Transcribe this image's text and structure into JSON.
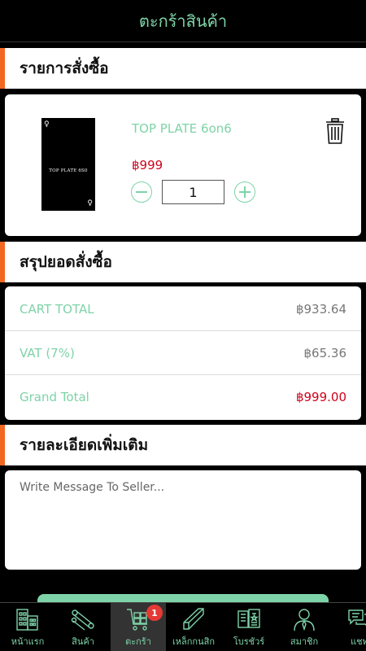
{
  "header": {
    "title": "ตะกร้าสินค้า"
  },
  "sections": {
    "order_items": "รายการสั่งซื้อ",
    "order_summary": "สรุปยอดสั่งซื้อ",
    "extra_details": "รายละเอียดเพิ่มเติม"
  },
  "cart_item": {
    "name": "TOP PLATE 6on6",
    "price": "฿999",
    "quantity": "1",
    "image_text": "TOP PLATE 6S0"
  },
  "summary": {
    "cart_total_label": "CART TOTAL",
    "cart_total_value": "฿933.64",
    "vat_label": "VAT (7%)",
    "vat_value": "฿65.36",
    "grand_total_label": "Grand Total",
    "grand_total_value": "฿999.00"
  },
  "message": {
    "placeholder": "Write Message To Seller..."
  },
  "nav": {
    "items": [
      {
        "label": "หน้าแรก",
        "icon": "home-building-icon"
      },
      {
        "label": "สินค้า",
        "icon": "steel-pipes-icon"
      },
      {
        "label": "ตะกร้า",
        "icon": "cart-icon",
        "badge": "1"
      },
      {
        "label": "เหล็กกนสิก",
        "icon": "steel-beam-icon"
      },
      {
        "label": "โบรชัวร์",
        "icon": "brochure-icon"
      },
      {
        "label": "สมาชิก",
        "icon": "member-icon"
      },
      {
        "label": "แชท",
        "icon": "chat-icon"
      }
    ]
  },
  "colors": {
    "accent_green": "#7ed3a8",
    "accent_orange": "#f26722",
    "price_red": "#d0021b",
    "badge_red": "#e53935"
  }
}
